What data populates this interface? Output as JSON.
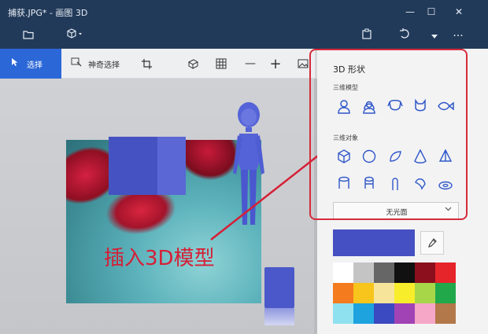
{
  "window": {
    "title": "捕获.JPG* - 画图 3D",
    "controls": {
      "minimize": "—",
      "maximize": "☐",
      "close": "✕"
    }
  },
  "appbar": {
    "icons": [
      "folder-icon",
      "cube-menu-icon",
      "paste-icon",
      "undo-icon",
      "dropdown-icon",
      "more-icon"
    ],
    "more_label": "···"
  },
  "toolbar": {
    "select_label": "选择",
    "magic_select_label": "神奇选择",
    "tools": [
      "crop-icon",
      "3d-view-icon",
      "grid-icon",
      "zoom-out-icon",
      "zoom-in-icon",
      "image-icon"
    ],
    "zoom_out": "—",
    "zoom_in": "+"
  },
  "canvas": {
    "annotation": "插入3D模型"
  },
  "panel": {
    "title": "3D 形状",
    "models_label": "三维模型",
    "objects_label": "三维对象",
    "models": [
      "man-model-icon",
      "woman-model-icon",
      "dog-model-icon",
      "cat-model-icon",
      "fish-model-icon"
    ],
    "objects": [
      "cube-icon",
      "sphere-icon",
      "hemisphere-icon",
      "cone-icon",
      "pyramid-icon",
      "cylinder-icon",
      "tube-icon",
      "capsule-icon",
      "donut-icon",
      "torus-icon"
    ],
    "finish_value": "无光面",
    "current_color": "#4550c3",
    "swatches": [
      "#ffffff",
      "#c4c4c4",
      "#666666",
      "#111111",
      "#8b0f1d",
      "#e6252b",
      "#f47b1e",
      "#f7c51b",
      "#f6e49a",
      "#f7ed2b",
      "#a7d649",
      "#20a84b",
      "#8fe1ef",
      "#1ea3df",
      "#3b4ac0",
      "#a143b5",
      "#f6a6c7",
      "#b37849"
    ]
  }
}
